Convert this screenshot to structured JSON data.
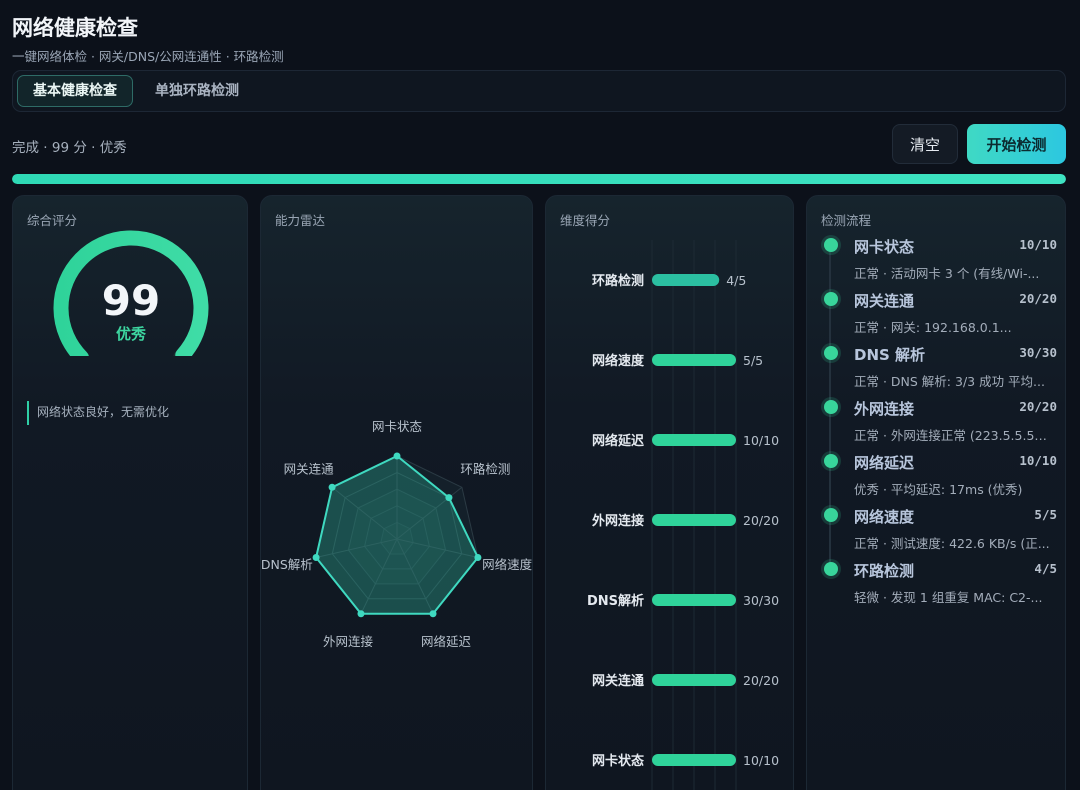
{
  "header": {
    "title": "网络健康检查",
    "subtitle": "一键网络体检 · 网关/DNS/公网连通性 · 环路检测"
  },
  "tabs": [
    {
      "label": "基本健康检查",
      "active": true
    },
    {
      "label": "单独环路检测",
      "active": false
    }
  ],
  "toolbar": {
    "status": "完成 · 99 分 · 优秀",
    "clear_label": "清空",
    "start_label": "开始检测",
    "progress_percent": 100
  },
  "colors": {
    "accent": "#3ddcb8",
    "good": "#38d59b",
    "button_start": "#3fd9c4"
  },
  "score_panel": {
    "title": "综合评分",
    "score": "99",
    "score_value": 99,
    "grade": "优秀",
    "note": "网络状态良好，无需优化"
  },
  "radar_panel": {
    "title": "能力雷达",
    "axes": [
      {
        "label": "网卡状态",
        "value": 10,
        "max": 10
      },
      {
        "label": "环路检测",
        "value": 4,
        "max": 5
      },
      {
        "label": "网络速度",
        "value": 5,
        "max": 5
      },
      {
        "label": "网络延迟",
        "value": 10,
        "max": 10
      },
      {
        "label": "外网连接",
        "value": 20,
        "max": 20
      },
      {
        "label": "DNS解析",
        "value": 30,
        "max": 30
      },
      {
        "label": "网关连通",
        "value": 20,
        "max": 20
      }
    ]
  },
  "dimension_panel": {
    "title": "维度得分",
    "rows": [
      {
        "label": "环路检测",
        "value": 4,
        "max": 5,
        "text": "4/5"
      },
      {
        "label": "网络速度",
        "value": 5,
        "max": 5,
        "text": "5/5"
      },
      {
        "label": "网络延迟",
        "value": 10,
        "max": 10,
        "text": "10/10"
      },
      {
        "label": "外网连接",
        "value": 20,
        "max": 20,
        "text": "20/20"
      },
      {
        "label": "DNS解析",
        "value": 30,
        "max": 30,
        "text": "30/30"
      },
      {
        "label": "网关连通",
        "value": 20,
        "max": 20,
        "text": "20/20"
      },
      {
        "label": "网卡状态",
        "value": 10,
        "max": 10,
        "text": "10/10"
      }
    ]
  },
  "flow_panel": {
    "title": "检测流程",
    "items": [
      {
        "name": "网卡状态",
        "score": "10/10",
        "desc": "正常 · 活动网卡 3 个 (有线/Wi-..."
      },
      {
        "name": "网关连通",
        "score": "20/20",
        "desc": "正常 · 网关: 192.168.0.1..."
      },
      {
        "name": "DNS 解析",
        "score": "30/30",
        "desc": "正常 · DNS 解析: 3/3 成功 平均..."
      },
      {
        "name": "外网连接",
        "score": "20/20",
        "desc": "正常 · 外网连接正常 (223.5.5.5)..."
      },
      {
        "name": "网络延迟",
        "score": "10/10",
        "desc": "优秀 · 平均延迟: 17ms (优秀)"
      },
      {
        "name": "网络速度",
        "score": "5/5",
        "desc": "正常 · 测试速度: 422.6 KB/s (正..."
      },
      {
        "name": "环路检测",
        "score": "4/5",
        "desc": "轻微 · 发现 1 组重复 MAC: C2-..."
      }
    ]
  }
}
